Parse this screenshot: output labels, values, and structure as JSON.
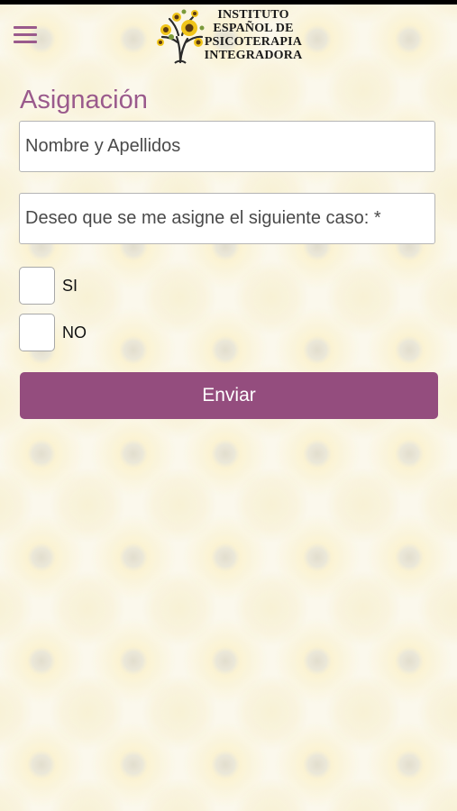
{
  "header": {
    "menu_icon": "hamburger-menu-icon",
    "logo_icon": "sunflower-tree-logo",
    "logo_lines": [
      "INSTITUTO",
      "ESPAÑOL DE",
      "PSICOTERAPIA",
      "INTEGRADORA"
    ]
  },
  "form": {
    "title": "Asignación",
    "name_placeholder": "Nombre y Apellidos",
    "case_placeholder": "Deseo que se me asigne el siguiente caso: *",
    "options": [
      {
        "label": "SI"
      },
      {
        "label": "NO"
      }
    ],
    "submit_label": "Enviar"
  },
  "colors": {
    "accent": "#944d7e",
    "title": "#9a5a8c",
    "background": "#fbf8ec"
  }
}
